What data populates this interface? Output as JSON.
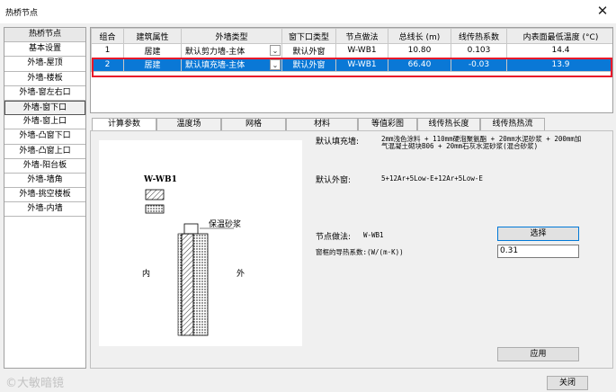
{
  "window": {
    "title": "热桥节点",
    "close_glyph": "✕"
  },
  "sidebar": {
    "header": "热桥节点",
    "items": [
      "基本设置",
      "外墙-屋顶",
      "外墙-楼板",
      "外墙-窗左右口",
      "外墙-窗下口",
      "外墙-窗上口",
      "外墙-凸窗下口",
      "外墙-凸窗上口",
      "外墙-阳台板",
      "外墙-墙角",
      "外墙-挑空楼板",
      "外墙-内墙"
    ],
    "active_index": 4
  },
  "grid": {
    "headers": [
      "组合",
      "建筑属性",
      "外墙类型",
      "窗下口类型",
      "节点做法",
      "总线长 (m)",
      "线传热系数",
      "内表面最低温度 (°C)"
    ],
    "rows": [
      [
        "1",
        "居建",
        "默认剪力墙-主体",
        "默认外窗",
        "W-WB1",
        "10.80",
        "0.103",
        "14.4"
      ],
      [
        "2",
        "居建",
        "默认填充墙-主体",
        "默认外窗",
        "W-WB1",
        "66.40",
        "-0.03",
        "13.9"
      ]
    ],
    "selected_row": 1,
    "combo_arrow": "⌄"
  },
  "tabs": [
    "计算参数",
    "温度场",
    "网格",
    "材料",
    "等值彩图",
    "线传热长度",
    "线传热热流"
  ],
  "active_tab": 0,
  "diagram": {
    "code": "W-WB1",
    "inside_label": "内",
    "outside_label": "外",
    "mortar_label": "保温砂浆"
  },
  "params": {
    "fill_label": "默认填充墙:",
    "fill_value_line1": "2mm浅色涂料 + 110mm硬泡聚氨酯 + 20mm水泥砂浆 + 200mm加",
    "fill_value_line2": "气混凝土砌块B06 + 20mm石灰水泥砂浆(混合砂浆)",
    "window_label": "默认外窗:",
    "window_value": "5+12Ar+5Low-E+12Ar+5Low-E",
    "node_label": "节点做法:",
    "node_value": "W-WB1",
    "select_button": "选择",
    "frame_label": "窗框的导热系数:(W/(m·K))",
    "frame_value": "0.31",
    "apply_button": "应用"
  },
  "footer": {
    "close_button": "关闭",
    "watermark": "©大敏暗镜"
  }
}
